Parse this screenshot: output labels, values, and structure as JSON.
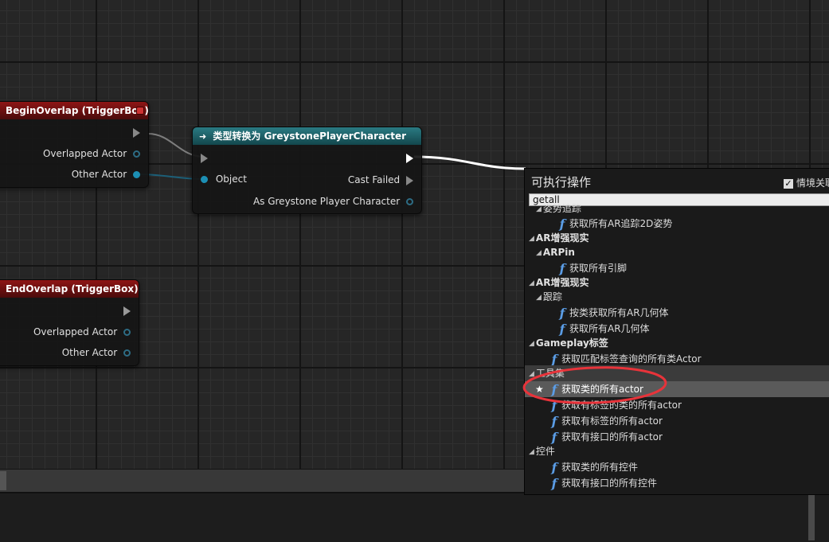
{
  "nodes": {
    "begin_overlap": {
      "title": "BeginOverlap (TriggerBox)",
      "pins": [
        "Overlapped Actor",
        "Other Actor"
      ]
    },
    "end_overlap": {
      "title": "EndOverlap (TriggerBox)",
      "pins": [
        "Overlapped Actor",
        "Other Actor"
      ]
    },
    "cast": {
      "title": "类型转换为 GreystonePlayerCharacter",
      "object_pin": "Object",
      "cast_failed_pin": "Cast Failed",
      "as_pin": "As Greystone Player Character"
    }
  },
  "context_menu": {
    "title": "可执行操作",
    "context_toggle_label": "情境关联",
    "search_value": "getall",
    "items": [
      {
        "kind": "cat-sub",
        "label": "姿势追踪"
      },
      {
        "kind": "fn",
        "label": "获取所有AR追踪2D姿势"
      },
      {
        "kind": "cat",
        "label": "AR增强现实"
      },
      {
        "kind": "cat",
        "label": "ARPin"
      },
      {
        "kind": "fn",
        "label": "获取所有引脚"
      },
      {
        "kind": "cat",
        "label": "AR增强现实"
      },
      {
        "kind": "cat-sub",
        "label": "跟踪"
      },
      {
        "kind": "fn",
        "label": "按类获取所有AR几何体"
      },
      {
        "kind": "fn",
        "label": "获取所有AR几何体"
      },
      {
        "kind": "cat",
        "label": "Gameplay标签"
      },
      {
        "kind": "fn",
        "label": "获取匹配标签查询的所有类Actor"
      },
      {
        "kind": "cat",
        "label": "工具集"
      },
      {
        "kind": "fn",
        "label": "获取类的所有actor"
      },
      {
        "kind": "fn",
        "label": "获取有标签的类的所有actor"
      },
      {
        "kind": "fn",
        "label": "获取有标签的所有actor"
      },
      {
        "kind": "fn",
        "label": "获取有接口的所有actor"
      },
      {
        "kind": "cat-sub",
        "label": "控件"
      },
      {
        "kind": "fn",
        "label": "获取类的所有控件"
      },
      {
        "kind": "fn",
        "label": "获取有接口的所有控件"
      }
    ]
  },
  "colors": {
    "event_header": "#8e1515",
    "cast_header": "#2a7a82",
    "object_pin": "#1c8fb4",
    "function_icon": "#5b9de6",
    "annotation": "#e8333a"
  }
}
